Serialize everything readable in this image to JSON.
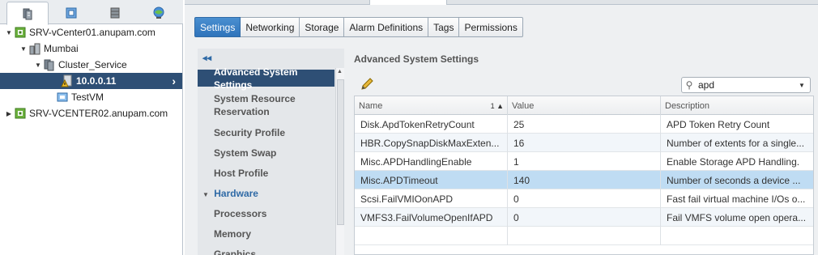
{
  "nav": {
    "tabs": [
      {
        "icon": "hosts-clusters-icon",
        "active": true
      },
      {
        "icon": "vms-templates-icon"
      },
      {
        "icon": "storage-icon"
      },
      {
        "icon": "networking-icon"
      }
    ],
    "tree": [
      {
        "label": "SRV-vCenter01.anupam.com",
        "icon": "vcenter-icon",
        "level": 0,
        "expanded": true
      },
      {
        "label": "Mumbai",
        "icon": "datacenter-icon",
        "level": 1,
        "expanded": true
      },
      {
        "label": "Cluster_Service",
        "icon": "cluster-icon",
        "level": 2,
        "expanded": true
      },
      {
        "label": "10.0.0.11",
        "icon": "host-warning-icon",
        "level": 3,
        "selected": true
      },
      {
        "label": "TestVM",
        "icon": "vm-icon",
        "level": 3
      },
      {
        "label": "SRV-VCENTER02.anupam.com",
        "icon": "vcenter-icon",
        "level": 0,
        "expanded": false
      }
    ]
  },
  "subtabs": [
    "Settings",
    "Networking",
    "Storage",
    "Alarm Definitions",
    "Tags",
    "Permissions"
  ],
  "settings_nav": {
    "items": [
      {
        "label": "Advanced System Settings",
        "selected": true
      },
      {
        "label": "System Resource Reservation"
      },
      {
        "label": "Security Profile"
      },
      {
        "label": "System Swap"
      },
      {
        "label": "Host Profile"
      },
      {
        "label": "Hardware",
        "header": true
      },
      {
        "label": "Processors"
      },
      {
        "label": "Memory"
      },
      {
        "label": "Graphics"
      }
    ]
  },
  "panel": {
    "title": "Advanced System Settings",
    "search_value": "apd",
    "columns": {
      "name": "Name",
      "value": "Value",
      "description": "Description",
      "sort_indicator": "1 ▲"
    },
    "rows": [
      {
        "name": "Disk.ApdTokenRetryCount",
        "value": "25",
        "description": "APD Token Retry Count"
      },
      {
        "name": "HBR.CopySnapDiskMaxExten...",
        "value": "16",
        "description": "Number of extents for a single..."
      },
      {
        "name": "Misc.APDHandlingEnable",
        "value": "1",
        "description": "Enable Storage APD Handling."
      },
      {
        "name": "Misc.APDTimeout",
        "value": "140",
        "description": "Number of seconds a device ..."
      },
      {
        "name": "Scsi.FailVMIOonAPD",
        "value": "0",
        "description": "Fast fail virtual machine I/Os o..."
      },
      {
        "name": "VMFS3.FailVolumeOpenIfAPD",
        "value": "0",
        "description": "Fail VMFS volume open opera..."
      }
    ]
  },
  "colors": {
    "selected_nav": "#2e4f75",
    "accent": "#2f74bb",
    "row_selected": "#bfdcf3"
  }
}
